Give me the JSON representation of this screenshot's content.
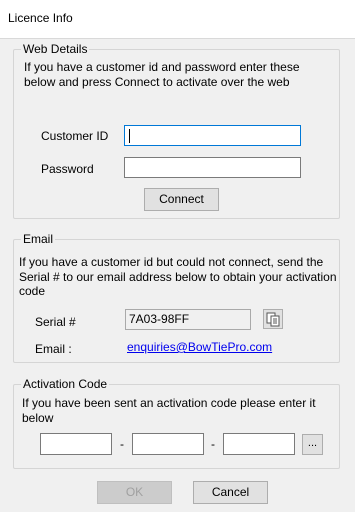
{
  "window": {
    "title": "Licence Info"
  },
  "web": {
    "legend": "Web Details",
    "description": "If you have a customer id and password enter these below  and press Connect to activate over the web",
    "customer_id_label": "Customer ID",
    "customer_id_value": "",
    "password_label": "Password",
    "password_value": "",
    "connect_label": "Connect"
  },
  "email": {
    "legend": "Email",
    "description": "If you have a customer id but could not connect, send the Serial # to our email address below to obtain your activation code",
    "serial_label": "Serial #",
    "serial_value": "7A03-98FF",
    "email_label": "Email :",
    "email_value": "enquiries@BowTiePro.com",
    "copy_icon": "copy-icon",
    "link_color": "#0000ee"
  },
  "activation": {
    "legend": "Activation Code",
    "description": "If you have been sent an activation code please enter it below",
    "separator": "-",
    "code_1": "",
    "code_2": "",
    "code_3": "",
    "browse_label": "..."
  },
  "footer": {
    "ok_label": "OK",
    "cancel_label": "Cancel"
  }
}
